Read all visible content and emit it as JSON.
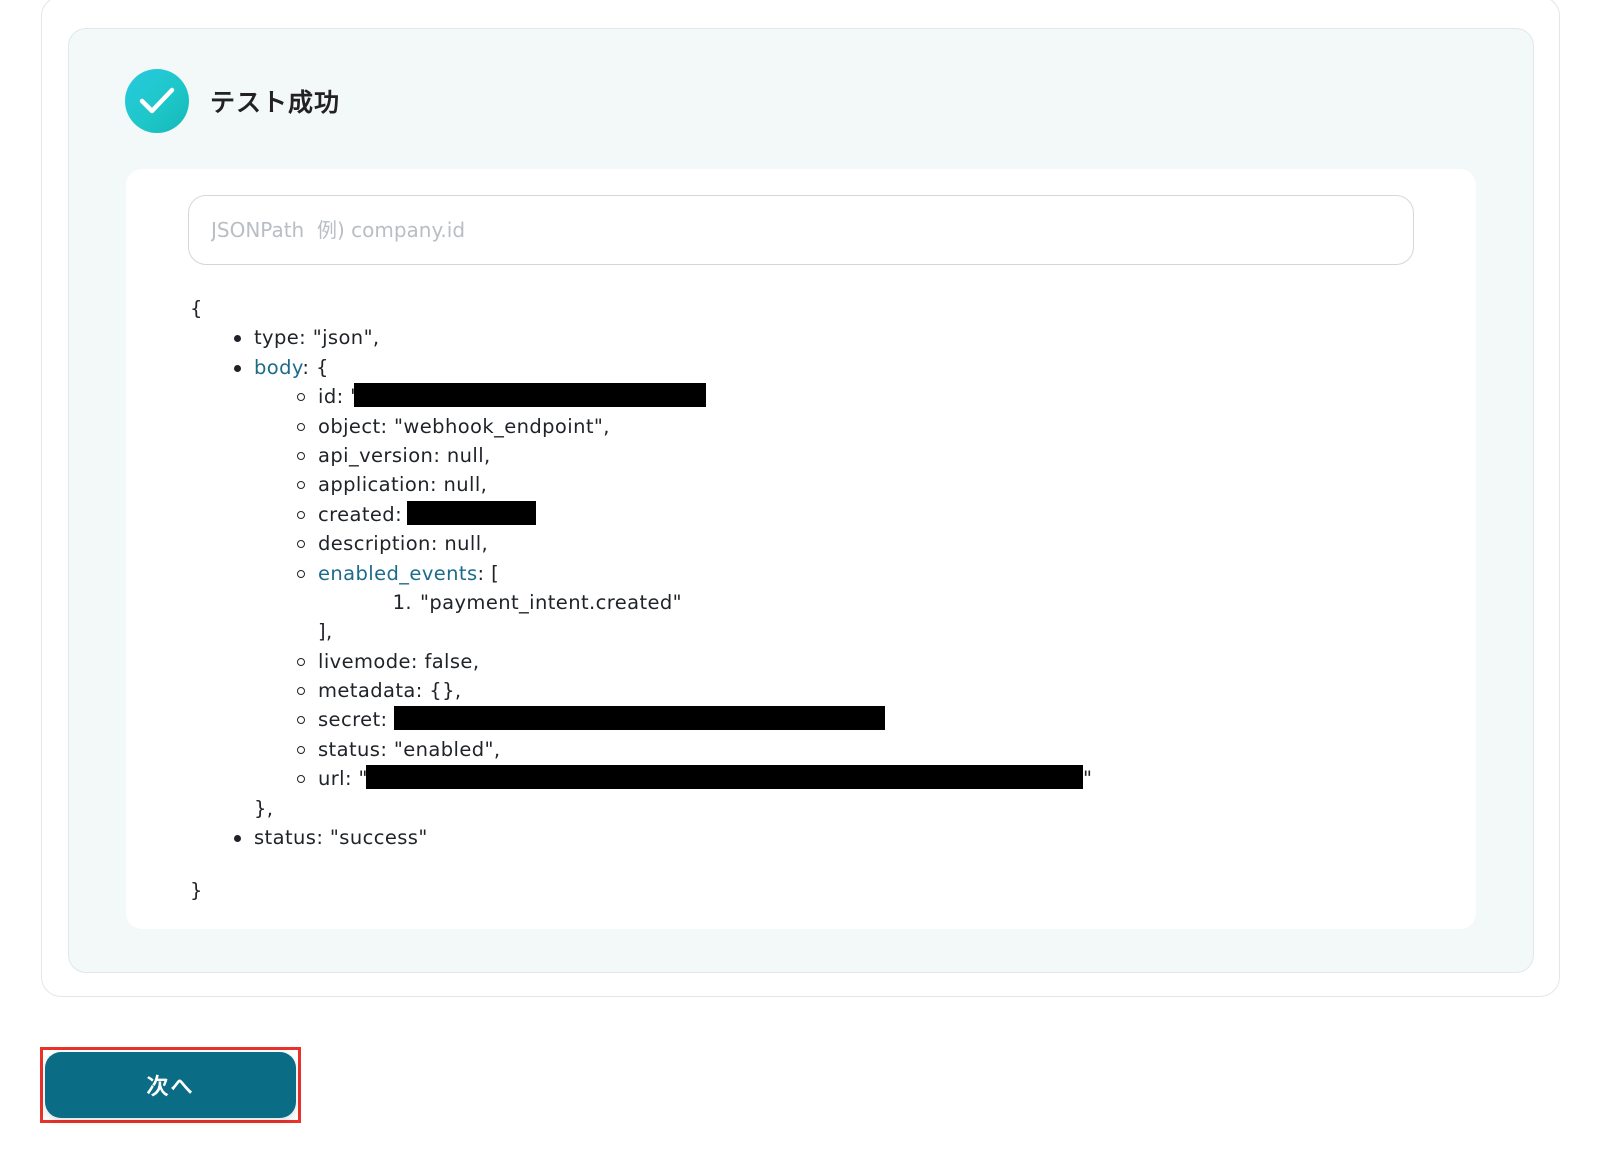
{
  "status": {
    "title": "テスト成功",
    "icon": "check-icon",
    "accent": "#1ec7c9"
  },
  "jsonpath": {
    "placeholder": "JSONPath  例) company.id",
    "value": ""
  },
  "json": {
    "open_brace": "{",
    "close_brace": "}",
    "type_line": "type: \"json\",",
    "body_key": "body",
    "body_open": ": {",
    "fields": {
      "id": "id: \"",
      "object": "object: \"webhook_endpoint\",",
      "api_version": "api_version: null,",
      "application": "application: null,",
      "created": "created: ",
      "description": "description: null,",
      "enabled_events_key": "enabled_events",
      "enabled_events_open": ": [",
      "enabled_events_item_num": "1.",
      "enabled_events_item": "\"payment_intent.created\"",
      "enabled_events_close": "],",
      "livemode": "livemode: false,",
      "metadata": "metadata: {},",
      "secret": "secret: ",
      "status": "status: \"enabled\",",
      "url": "url: \"",
      "url_tail": "\""
    },
    "body_close": "},",
    "status_line": "status: \"success\""
  },
  "next_button": {
    "label": "次へ",
    "color": "#0b6d85",
    "highlight": "#e8322a"
  },
  "link_color": "#1d6b8a"
}
